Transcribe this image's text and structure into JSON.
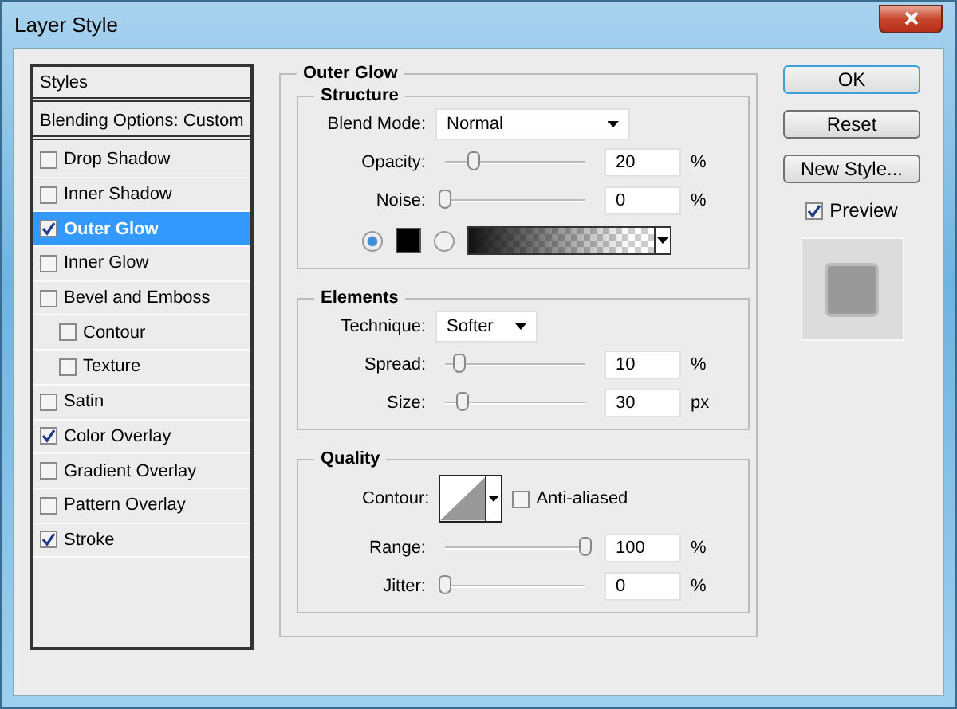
{
  "window": {
    "title": "Layer Style"
  },
  "styles_list": [
    {
      "kind": "header",
      "label": "Styles"
    },
    {
      "kind": "header",
      "label": "Blending Options: Custom"
    },
    {
      "kind": "option",
      "label": "Drop Shadow",
      "checked": false,
      "selected": false
    },
    {
      "kind": "option",
      "label": "Inner Shadow",
      "checked": false,
      "selected": false
    },
    {
      "kind": "option",
      "label": "Outer Glow",
      "checked": true,
      "selected": true
    },
    {
      "kind": "option",
      "label": "Inner Glow",
      "checked": false,
      "selected": false
    },
    {
      "kind": "option",
      "label": "Bevel and Emboss",
      "checked": false,
      "selected": false,
      "children": [
        {
          "kind": "option",
          "label": "Contour",
          "checked": false,
          "selected": false
        },
        {
          "kind": "option",
          "label": "Texture",
          "checked": false,
          "selected": false
        }
      ]
    },
    {
      "kind": "option",
      "label": "Satin",
      "checked": false,
      "selected": false
    },
    {
      "kind": "option",
      "label": "Color Overlay",
      "checked": true,
      "selected": false
    },
    {
      "kind": "option",
      "label": "Gradient Overlay",
      "checked": false,
      "selected": false
    },
    {
      "kind": "option",
      "label": "Pattern Overlay",
      "checked": false,
      "selected": false
    },
    {
      "kind": "option",
      "label": "Stroke",
      "checked": true,
      "selected": false
    }
  ],
  "panel": {
    "title": "Outer Glow",
    "structure": {
      "title": "Structure",
      "blend_mode": {
        "label": "Blend Mode:",
        "value": "Normal"
      },
      "sliders": [
        {
          "label": "Opacity:",
          "level": 0.2,
          "value": "20",
          "unit": "%"
        },
        {
          "label": "Noise:",
          "level": 0,
          "value": "0",
          "unit": "%"
        }
      ],
      "glow_source": [
        {
          "kind": "color",
          "selected": true,
          "color": "#000000"
        },
        {
          "kind": "gradient",
          "selected": false
        }
      ]
    },
    "elements": {
      "title": "Elements",
      "technique": {
        "label": "Technique:",
        "value": "Softer"
      },
      "sliders": [
        {
          "label": "Spread:",
          "level": 0.1,
          "value": "10",
          "unit": "%"
        },
        {
          "label": "Size:",
          "level": 0.13,
          "value": "30",
          "unit": "px"
        }
      ]
    },
    "quality": {
      "title": "Quality",
      "contour_label": "Contour:",
      "anti_aliased": {
        "label": "Anti-aliased",
        "checked": false
      },
      "sliders": [
        {
          "label": "Range:",
          "level": 1,
          "value": "100",
          "unit": "%"
        },
        {
          "label": "Jitter:",
          "level": 0,
          "value": "0",
          "unit": "%"
        }
      ]
    }
  },
  "buttons": [
    {
      "label": "OK",
      "default": true
    },
    {
      "label": "Reset",
      "default": false
    },
    {
      "label": "New Style...",
      "default": false
    }
  ],
  "preview": {
    "label": "Preview",
    "checked": true
  }
}
